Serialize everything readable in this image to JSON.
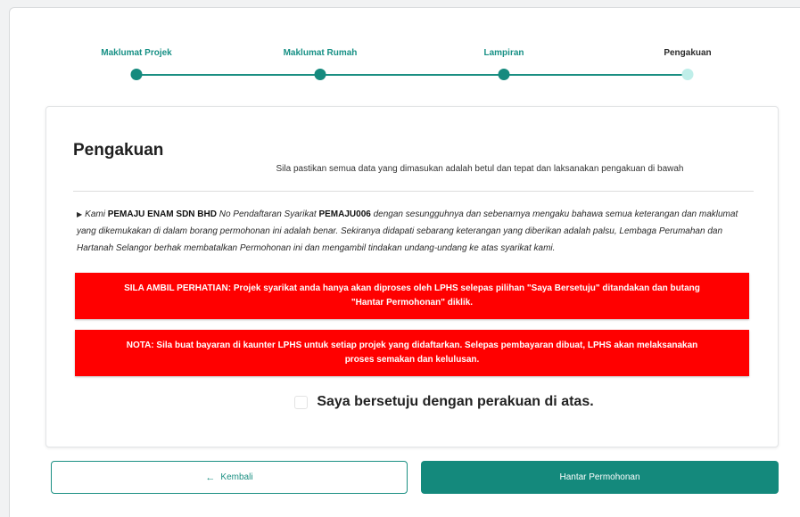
{
  "stepper": {
    "steps": [
      {
        "label": "Maklumat Projek",
        "state": "done"
      },
      {
        "label": "Maklumat Rumah",
        "state": "done"
      },
      {
        "label": "Lampiran",
        "state": "done"
      },
      {
        "label": "Pengakuan",
        "state": "current"
      }
    ],
    "colors": {
      "done": "#168a7e",
      "current": "#bfeee9"
    }
  },
  "panel": {
    "title": "Pengakuan",
    "subtitle": "Sila pastikan semua data yang dimasukan adalah betul dan tepat dan laksanakan pengakuan di bawah",
    "declaration": {
      "prefix": "Kami ",
      "company_name": "PEMAJU ENAM SDN BHD",
      "middle": " No Pendaftaran Syarikat ",
      "registration_no": "PEMAJU006",
      "suffix": " dengan sesungguhnya dan sebenarnya mengaku bahawa semua keterangan dan maklumat yang dikemukakan di dalam borang permohonan ini adalah benar. Sekiranya didapati sebarang keterangan yang diberikan adalah palsu, Lembaga Perumahan dan Hartanah Selangor berhak membatalkan Permohonan ini dan mengambil tindakan undang-undang ke atas syarikat kami."
    },
    "alerts": [
      "SILA AMBIL PERHATIAN: Projek syarikat anda hanya akan diproses oleh LPHS selepas pilihan \"Saya Bersetuju\" ditandakan dan butang \"Hantar Permohonan\" diklik.",
      "NOTA: Sila buat bayaran di kaunter LPHS untuk setiap projek yang didaftarkan. Selepas pembayaran dibuat, LPHS akan melaksanakan proses semakan dan kelulusan."
    ],
    "agree_label": "Saya bersetuju dengan perakuan di atas.",
    "alert_color": "#ff0000"
  },
  "actions": {
    "back_icon": "←",
    "back_label": "Kembali",
    "submit_label": "Hantar Permohonan",
    "accent_color": "#14897c"
  }
}
